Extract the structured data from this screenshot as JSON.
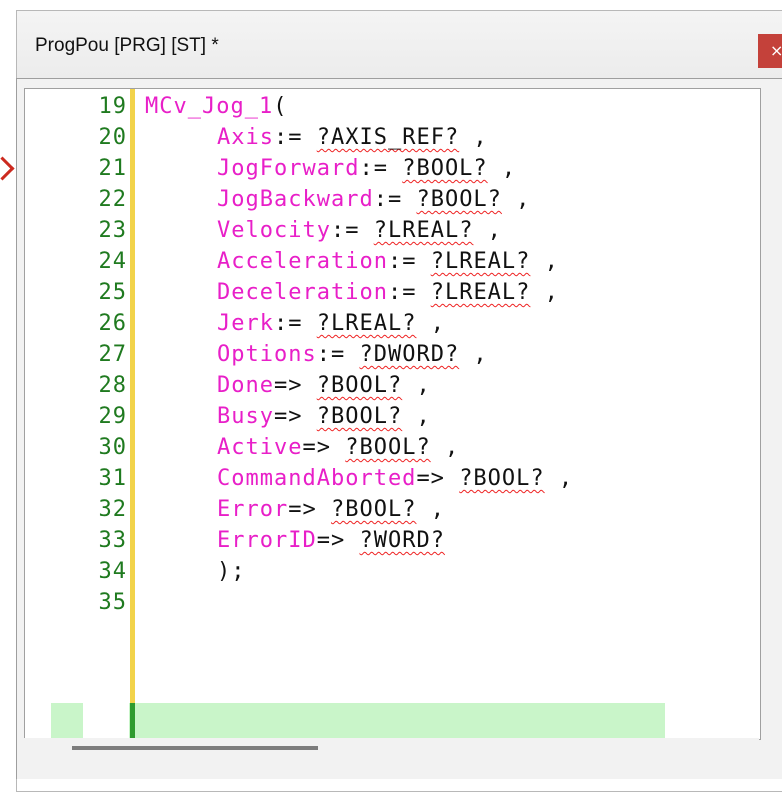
{
  "window": {
    "title": "ProgPou [PRG] [ST] *",
    "close_glyph": "×"
  },
  "editor": {
    "lines": [
      {
        "num": "19",
        "indent": 0,
        "parts": [
          {
            "t": "MCv_Jog_1",
            "c": "kw"
          },
          {
            "t": "(",
            "c": "op"
          }
        ]
      },
      {
        "num": "20",
        "indent": 2,
        "parts": [
          {
            "t": "Axis",
            "c": "kw"
          },
          {
            "t": ":= ",
            "c": "op"
          },
          {
            "t": "?AXIS_REF?",
            "c": "ph"
          },
          {
            "t": " ,",
            "c": "op"
          }
        ]
      },
      {
        "num": "21",
        "indent": 2,
        "parts": [
          {
            "t": "JogForward",
            "c": "kw"
          },
          {
            "t": ":= ",
            "c": "op"
          },
          {
            "t": "?BOOL?",
            "c": "ph"
          },
          {
            "t": " ,",
            "c": "op"
          }
        ]
      },
      {
        "num": "22",
        "indent": 2,
        "parts": [
          {
            "t": "JogBackward",
            "c": "kw"
          },
          {
            "t": ":= ",
            "c": "op"
          },
          {
            "t": "?BOOL?",
            "c": "ph"
          },
          {
            "t": " ,",
            "c": "op"
          }
        ]
      },
      {
        "num": "23",
        "indent": 2,
        "parts": [
          {
            "t": "Velocity",
            "c": "kw"
          },
          {
            "t": ":= ",
            "c": "op"
          },
          {
            "t": "?LREAL?",
            "c": "ph"
          },
          {
            "t": " ,",
            "c": "op"
          }
        ]
      },
      {
        "num": "24",
        "indent": 2,
        "parts": [
          {
            "t": "Acceleration",
            "c": "kw"
          },
          {
            "t": ":= ",
            "c": "op"
          },
          {
            "t": "?LREAL?",
            "c": "ph"
          },
          {
            "t": " ,",
            "c": "op"
          }
        ]
      },
      {
        "num": "25",
        "indent": 2,
        "parts": [
          {
            "t": "Deceleration",
            "c": "kw"
          },
          {
            "t": ":= ",
            "c": "op"
          },
          {
            "t": "?LREAL?",
            "c": "ph"
          },
          {
            "t": " ,",
            "c": "op"
          }
        ]
      },
      {
        "num": "26",
        "indent": 2,
        "parts": [
          {
            "t": "Jerk",
            "c": "kw"
          },
          {
            "t": ":= ",
            "c": "op"
          },
          {
            "t": "?LREAL?",
            "c": "ph"
          },
          {
            "t": " ,",
            "c": "op"
          }
        ]
      },
      {
        "num": "27",
        "indent": 2,
        "parts": [
          {
            "t": "Options",
            "c": "kw"
          },
          {
            "t": ":= ",
            "c": "op"
          },
          {
            "t": "?DWORD?",
            "c": "ph"
          },
          {
            "t": " ,",
            "c": "op"
          }
        ]
      },
      {
        "num": "28",
        "indent": 2,
        "parts": [
          {
            "t": "Done",
            "c": "kw"
          },
          {
            "t": "=> ",
            "c": "op"
          },
          {
            "t": "?BOOL?",
            "c": "ph"
          },
          {
            "t": " ,",
            "c": "op"
          }
        ]
      },
      {
        "num": "29",
        "indent": 2,
        "parts": [
          {
            "t": "Busy",
            "c": "kw"
          },
          {
            "t": "=> ",
            "c": "op"
          },
          {
            "t": "?BOOL?",
            "c": "ph"
          },
          {
            "t": " ,",
            "c": "op"
          }
        ]
      },
      {
        "num": "30",
        "indent": 2,
        "parts": [
          {
            "t": "Active",
            "c": "kw"
          },
          {
            "t": "=> ",
            "c": "op"
          },
          {
            "t": "?BOOL?",
            "c": "ph"
          },
          {
            "t": " ,",
            "c": "op"
          }
        ]
      },
      {
        "num": "31",
        "indent": 2,
        "parts": [
          {
            "t": "CommandAborted",
            "c": "kw"
          },
          {
            "t": "=> ",
            "c": "op"
          },
          {
            "t": "?BOOL?",
            "c": "ph"
          },
          {
            "t": " ,",
            "c": "op"
          }
        ]
      },
      {
        "num": "32",
        "indent": 2,
        "parts": [
          {
            "t": "Error",
            "c": "kw"
          },
          {
            "t": "=> ",
            "c": "op"
          },
          {
            "t": "?BOOL?",
            "c": "ph"
          },
          {
            "t": " ,",
            "c": "op"
          }
        ]
      },
      {
        "num": "33",
        "indent": 2,
        "parts": [
          {
            "t": "ErrorID",
            "c": "kw"
          },
          {
            "t": "=> ",
            "c": "op"
          },
          {
            "t": "?WORD?",
            "c": "ph"
          }
        ]
      },
      {
        "num": "34",
        "indent": 2,
        "parts": [
          {
            "t": ");",
            "c": "op"
          }
        ]
      },
      {
        "num": "35",
        "indent": 0,
        "parts": []
      }
    ],
    "current_line": "35"
  },
  "colors": {
    "identifier": "#e81fc8",
    "line_number": "#1f7a1f",
    "current_line_bg": "#c9f5c9",
    "changed_bar": "#f2d34a",
    "close_button": "#c4413a"
  },
  "icons": {
    "splitter": "splitter-icon"
  },
  "split_glyph": "⇟"
}
